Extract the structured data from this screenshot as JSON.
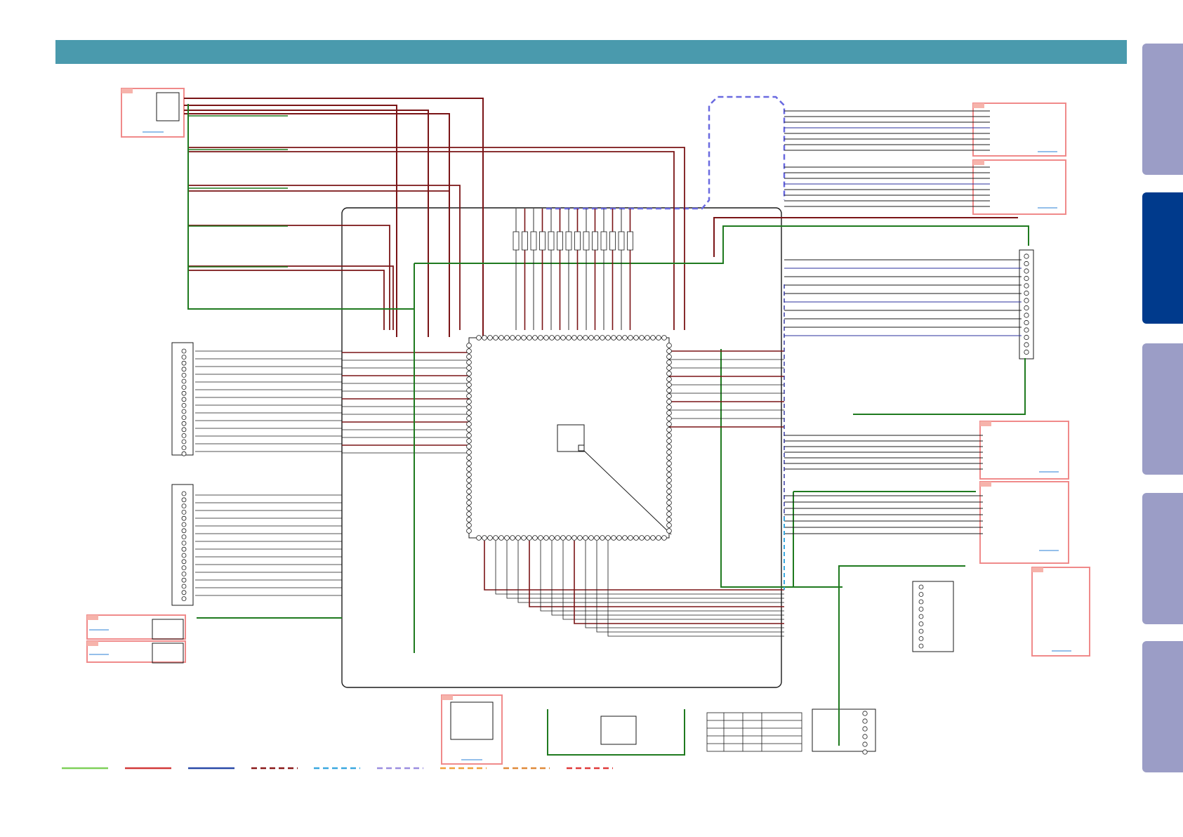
{
  "colors": {
    "header": "#4a9aad",
    "tab_inactive": "#9b9dc6",
    "tab_active": "#003a8c",
    "wire_black": "#1a1a1a",
    "wire_red": "#7a1416",
    "wire_green": "#1f7a1f",
    "wire_blue": "#2a2f9c",
    "ref_box": "#f08a8a"
  },
  "side_tabs": [
    {
      "state": "inactive"
    },
    {
      "state": "active"
    },
    {
      "state": "inactive"
    },
    {
      "state": "inactive"
    },
    {
      "state": "inactive"
    }
  ],
  "legend": [
    {
      "style": "solid",
      "color": "#7fd05a"
    },
    {
      "style": "solid",
      "color": "#d23a3a"
    },
    {
      "style": "solid",
      "color": "#2a4aa8"
    },
    {
      "style": "dashed",
      "color": "#8a1a1a"
    },
    {
      "style": "dashed",
      "color": "#3aa8e0"
    },
    {
      "style": "dashed",
      "color": "#9b8ee0"
    },
    {
      "style": "dashed",
      "color": "#f0a03a"
    },
    {
      "style": "dashed",
      "color": "#e08a3a"
    },
    {
      "style": "dashed",
      "color": "#e03a3a"
    }
  ]
}
